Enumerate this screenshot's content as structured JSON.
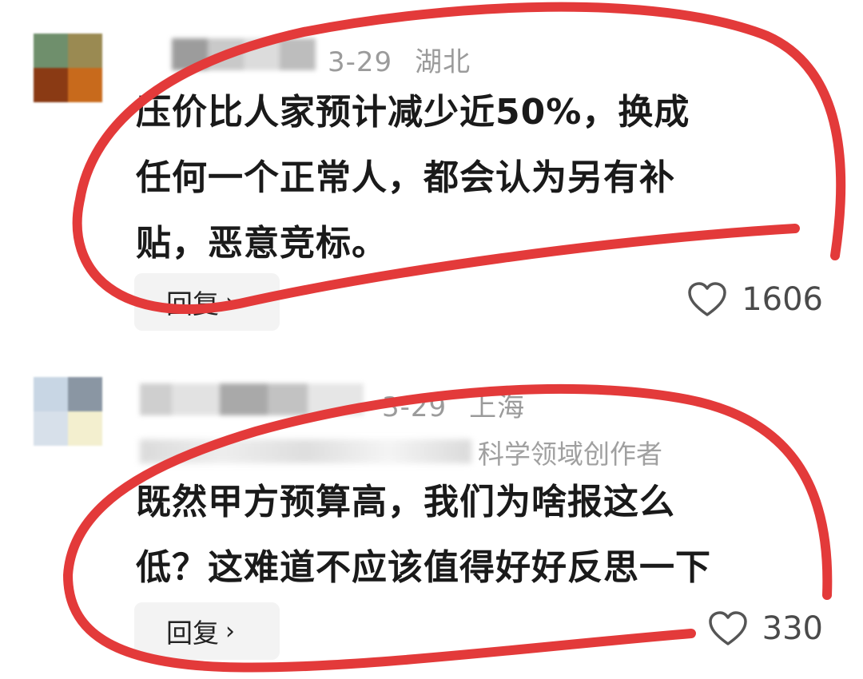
{
  "comments": [
    {
      "date": "3-29",
      "location": "湖北",
      "text_lines": [
        "压价比人家预计减少近50%，换成",
        "任何一个正常人，都会认为另有补",
        "贴，恶意竞标。"
      ],
      "reply_label": "回复",
      "reply_chevron": "›",
      "like_icon": "heart-outline-icon",
      "likes": "1606"
    },
    {
      "date": "3-29",
      "location": "上海",
      "badge": "科学领域创作者",
      "text_lines": [
        "既然甲方预算高，我们为啥报这么",
        "低？这难道不应该值得好好反思一下"
      ],
      "reply_label": "回复",
      "reply_chevron": "›",
      "like_icon": "heart-outline-icon",
      "likes": "330"
    }
  ],
  "colors": {
    "annotation_red": "#e33a3a",
    "meta_gray": "#9b9b9b",
    "reply_bg": "#f3f3f3"
  }
}
